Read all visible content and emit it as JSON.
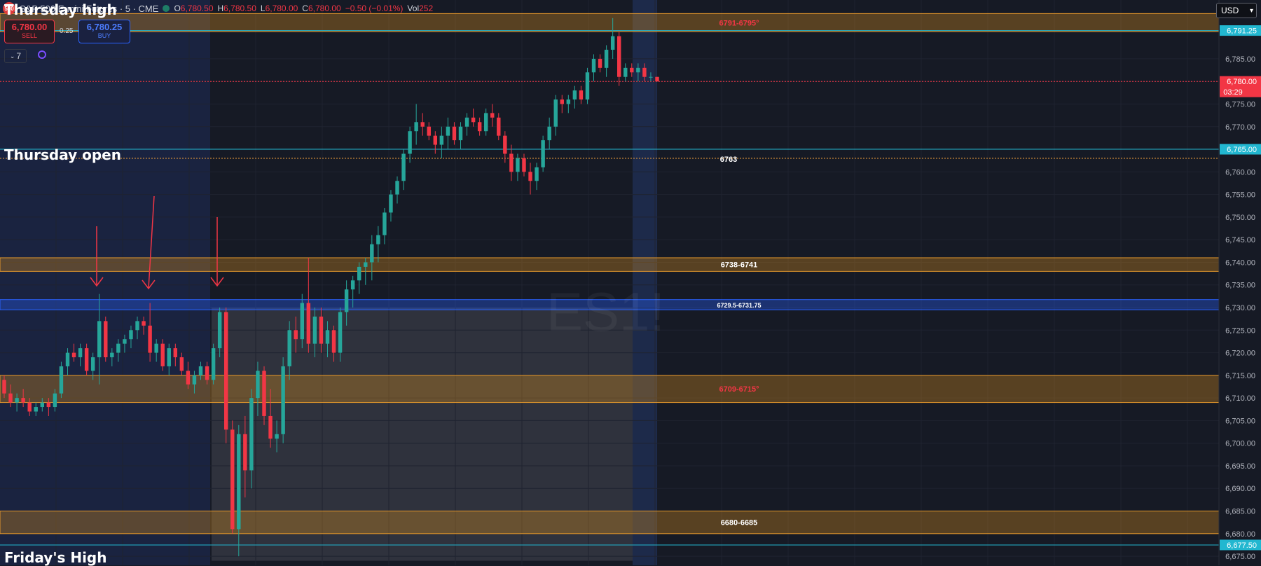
{
  "header": {
    "logo": "500",
    "title": "S&P 500 E-mini Futures · 5 · CME",
    "ohlc": [
      {
        "k": "O",
        "v": "6,780.50"
      },
      {
        "k": "H",
        "v": "6,780.50"
      },
      {
        "k": "L",
        "v": "6,780.00"
      },
      {
        "k": "C",
        "v": "6,780.00"
      },
      {
        "k": "",
        "v": "−0.50 (−0.01%)"
      }
    ],
    "vol_label": "Vol",
    "vol_value": "252"
  },
  "trade": {
    "sell_price": "6,780.00",
    "sell_label": "SELL",
    "spread": "0.25",
    "buy_price": "6,780.25",
    "buy_label": "BUY"
  },
  "indicators_count": "7",
  "currency": "USD",
  "watermark": "ES1!",
  "labels": {
    "thursday_high": "Thursday high",
    "thursday_open": "Thursday open",
    "friday_high": "Friday's High"
  },
  "colors": {
    "background": "#161a25",
    "up": "#26a69a",
    "down": "#f23645",
    "zone_orange": "#d48b1e",
    "zone_blue": "#2962ff",
    "cyan_line": "#22b7d0"
  },
  "chart_data": {
    "type": "candlestick",
    "symbol": "ES1!",
    "timeframe": "5",
    "ylim": [
      6673,
      6798
    ],
    "y_ticks": [
      6675,
      6680,
      6685,
      6690,
      6695,
      6700,
      6705,
      6710,
      6715,
      6720,
      6725,
      6730,
      6735,
      6740,
      6745,
      6750,
      6755,
      6760,
      6765,
      6770,
      6775,
      6780,
      6785
    ],
    "price_tags": [
      {
        "value": "6,791.25",
        "price": 6791.25,
        "color": "#22b7d0"
      },
      {
        "value": "6,780.00",
        "price": 6780.0,
        "color": "#f23645",
        "countdown": "03:29"
      },
      {
        "value": "6,765.00",
        "price": 6765.0,
        "color": "#22b7d0"
      },
      {
        "value": "6,677.50",
        "price": 6677.5,
        "color": "#22b7d0"
      }
    ],
    "zones": [
      {
        "label": "6791-6795°",
        "low": 6791,
        "high": 6795,
        "color": "orange",
        "text_color": "#f23645"
      },
      {
        "label": "6738-6741",
        "low": 6738,
        "high": 6741,
        "color": "orange",
        "text_color": "#ffffff"
      },
      {
        "label": "6729.5-6731.75",
        "low": 6729.5,
        "high": 6731.75,
        "color": "blue",
        "text_color": "#ffffff"
      },
      {
        "label": "6709-6715°",
        "low": 6709,
        "high": 6715,
        "color": "orange",
        "text_color": "#f23645"
      },
      {
        "label": "6680-6685",
        "low": 6680,
        "high": 6685,
        "color": "orange",
        "text_color": "#ffffff"
      }
    ],
    "lines": [
      {
        "price": 6791.25,
        "label": "",
        "color": "#22b7d0"
      },
      {
        "price": 6765,
        "label": "",
        "color": "#22b7d0"
      },
      {
        "price": 6763,
        "label": "6763",
        "color": "#f2a03a",
        "dotted": true
      },
      {
        "price": 6780,
        "label": "",
        "color": "#f23645",
        "dotted": true
      },
      {
        "price": 6677.5,
        "label": "",
        "color": "#22b7d0"
      }
    ],
    "candles": [
      [
        6714,
        6715,
        6710,
        6711
      ],
      [
        6711,
        6713,
        6708,
        6709
      ],
      [
        6709,
        6711,
        6707,
        6710
      ],
      [
        6710,
        6712,
        6708,
        6709
      ],
      [
        6709,
        6710,
        6706,
        6707
      ],
      [
        6707,
        6709,
        6706,
        6708
      ],
      [
        6708,
        6710,
        6707,
        6709
      ],
      [
        6709,
        6710,
        6706,
        6708
      ],
      [
        6708,
        6712,
        6707,
        6711
      ],
      [
        6711,
        6718,
        6710,
        6717
      ],
      [
        6717,
        6721,
        6715,
        6720
      ],
      [
        6720,
        6722,
        6718,
        6719
      ],
      [
        6719,
        6722,
        6717,
        6721
      ],
      [
        6721,
        6722,
        6715,
        6716
      ],
      [
        6716,
        6720,
        6714,
        6719
      ],
      [
        6719,
        6733,
        6713,
        6727
      ],
      [
        6727,
        6728,
        6718,
        6719
      ],
      [
        6719,
        6721,
        6717,
        6720
      ],
      [
        6720,
        6723,
        6718,
        6722
      ],
      [
        6722,
        6724,
        6720,
        6723
      ],
      [
        6723,
        6726,
        6721,
        6725
      ],
      [
        6725,
        6728,
        6723,
        6727
      ],
      [
        6727,
        6728,
        6724,
        6726
      ],
      [
        6726,
        6731,
        6718,
        6720
      ],
      [
        6720,
        6723,
        6718,
        6722
      ],
      [
        6722,
        6723,
        6716,
        6717
      ],
      [
        6717,
        6722,
        6715,
        6721
      ],
      [
        6721,
        6722,
        6717,
        6719
      ],
      [
        6719,
        6720,
        6715,
        6716
      ],
      [
        6716,
        6718,
        6712,
        6713
      ],
      [
        6713,
        6716,
        6711,
        6715
      ],
      [
        6715,
        6718,
        6714,
        6717
      ],
      [
        6717,
        6718,
        6713,
        6714
      ],
      [
        6714,
        6722,
        6713,
        6721
      ],
      [
        6721,
        6730,
        6719,
        6729
      ],
      [
        6729,
        6730,
        6700,
        6703
      ],
      [
        6703,
        6705,
        6680,
        6681
      ],
      [
        6681,
        6704,
        6675,
        6702
      ],
      [
        6702,
        6706,
        6688,
        6694
      ],
      [
        6694,
        6712,
        6690,
        6710
      ],
      [
        6710,
        6718,
        6706,
        6716
      ],
      [
        6716,
        6717,
        6704,
        6706
      ],
      [
        6706,
        6712,
        6699,
        6701
      ],
      [
        6701,
        6705,
        6698,
        6702
      ],
      [
        6702,
        6719,
        6700,
        6717
      ],
      [
        6717,
        6727,
        6714,
        6725
      ],
      [
        6725,
        6728,
        6720,
        6723
      ],
      [
        6723,
        6733,
        6721,
        6731
      ],
      [
        6731,
        6741,
        6720,
        6722
      ],
      [
        6722,
        6730,
        6719,
        6728
      ],
      [
        6728,
        6730,
        6720,
        6722
      ],
      [
        6722,
        6727,
        6719,
        6725
      ],
      [
        6725,
        6726,
        6718,
        6720
      ],
      [
        6720,
        6730,
        6718,
        6729
      ],
      [
        6729,
        6736,
        6726,
        6734
      ],
      [
        6734,
        6737,
        6730,
        6736
      ],
      [
        6736,
        6740,
        6733,
        6739
      ],
      [
        6739,
        6741,
        6735,
        6740
      ],
      [
        6740,
        6746,
        6736,
        6744
      ],
      [
        6744,
        6748,
        6740,
        6746
      ],
      [
        6746,
        6752,
        6744,
        6751
      ],
      [
        6751,
        6756,
        6749,
        6755
      ],
      [
        6755,
        6759,
        6753,
        6758
      ],
      [
        6758,
        6765,
        6756,
        6764
      ],
      [
        6764,
        6770,
        6762,
        6769
      ],
      [
        6769,
        6775,
        6766,
        6771
      ],
      [
        6771,
        6773,
        6768,
        6770
      ],
      [
        6770,
        6771,
        6767,
        6768
      ],
      [
        6768,
        6769,
        6764,
        6766
      ],
      [
        6766,
        6770,
        6763,
        6768
      ],
      [
        6768,
        6772,
        6765,
        6770
      ],
      [
        6770,
        6771,
        6766,
        6767
      ],
      [
        6767,
        6771,
        6765,
        6770
      ],
      [
        6770,
        6773,
        6768,
        6772
      ],
      [
        6772,
        6774,
        6770,
        6771
      ],
      [
        6771,
        6772,
        6768,
        6769
      ],
      [
        6769,
        6774,
        6768,
        6773
      ],
      [
        6773,
        6775,
        6770,
        6772
      ],
      [
        6772,
        6773,
        6767,
        6768
      ],
      [
        6768,
        6769,
        6762,
        6764
      ],
      [
        6764,
        6766,
        6758,
        6760
      ],
      [
        6760,
        6764,
        6758,
        6763
      ],
      [
        6763,
        6764,
        6759,
        6760
      ],
      [
        6760,
        6762,
        6755,
        6758
      ],
      [
        6758,
        6762,
        6756,
        6761
      ],
      [
        6761,
        6768,
        6760,
        6767
      ],
      [
        6767,
        6772,
        6765,
        6770
      ],
      [
        6770,
        6777,
        6768,
        6776
      ],
      [
        6776,
        6777,
        6773,
        6775
      ],
      [
        6775,
        6777,
        6773,
        6776
      ],
      [
        6776,
        6779,
        6774,
        6778
      ],
      [
        6778,
        6779,
        6775,
        6776
      ],
      [
        6776,
        6783,
        6775,
        6782
      ],
      [
        6782,
        6786,
        6780,
        6785
      ],
      [
        6785,
        6786,
        6782,
        6783
      ],
      [
        6783,
        6788,
        6781,
        6787
      ],
      [
        6787,
        6794,
        6785,
        6790
      ],
      [
        6790,
        6791,
        6779,
        6781
      ],
      [
        6781,
        6784,
        6780,
        6783
      ],
      [
        6783,
        6784,
        6781,
        6782
      ],
      [
        6782,
        6784,
        6780,
        6783
      ],
      [
        6783,
        6784,
        6780,
        6781
      ],
      [
        6781,
        6782,
        6780,
        6781
      ],
      [
        6781,
        6781,
        6780,
        6780
      ]
    ],
    "annotation_arrows": 3
  }
}
